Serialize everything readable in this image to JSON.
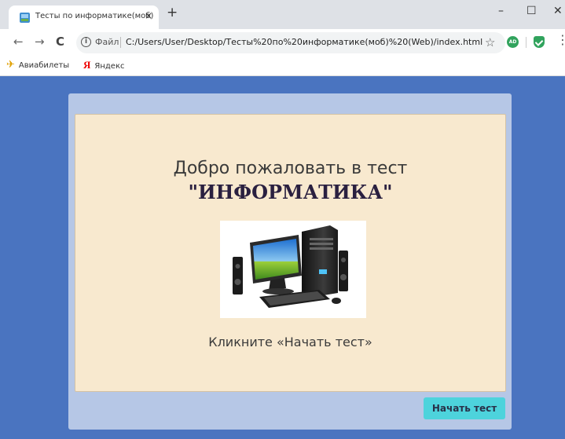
{
  "browser": {
    "tab_title": "Тесты по информатике(моб)",
    "tab_close": "×",
    "new_tab": "+",
    "window_controls": {
      "minimize": "–",
      "maximize": "☐",
      "close": "✕"
    },
    "nav": {
      "back": "←",
      "forward": "→",
      "reload": "C"
    },
    "address": {
      "info": "i",
      "scheme": "Файл",
      "url": "C:/Users/User/Desktop/Тесты%20по%20информатике(моб)%20(Web)/index.html"
    },
    "extensions": {
      "star": "☆",
      "ad_badge": "AD",
      "menu": "⋮"
    },
    "bookmarks": [
      {
        "icon": "plane-icon",
        "label": "Авиабилеты"
      },
      {
        "icon": "yandex-icon",
        "label": "Яндекс"
      }
    ]
  },
  "page": {
    "heading_line1": "Добро пожаловать в тест",
    "heading_line2": "\"ИНФОРМАТИКА\"",
    "hint": "Кликните «Начать тест»",
    "start_button": "Начать тест"
  },
  "colors": {
    "page_background": "#4a74c0",
    "outer_card": "#b6c7e6",
    "inner_card": "#f8e9cf",
    "button": "#4dd3dc"
  }
}
